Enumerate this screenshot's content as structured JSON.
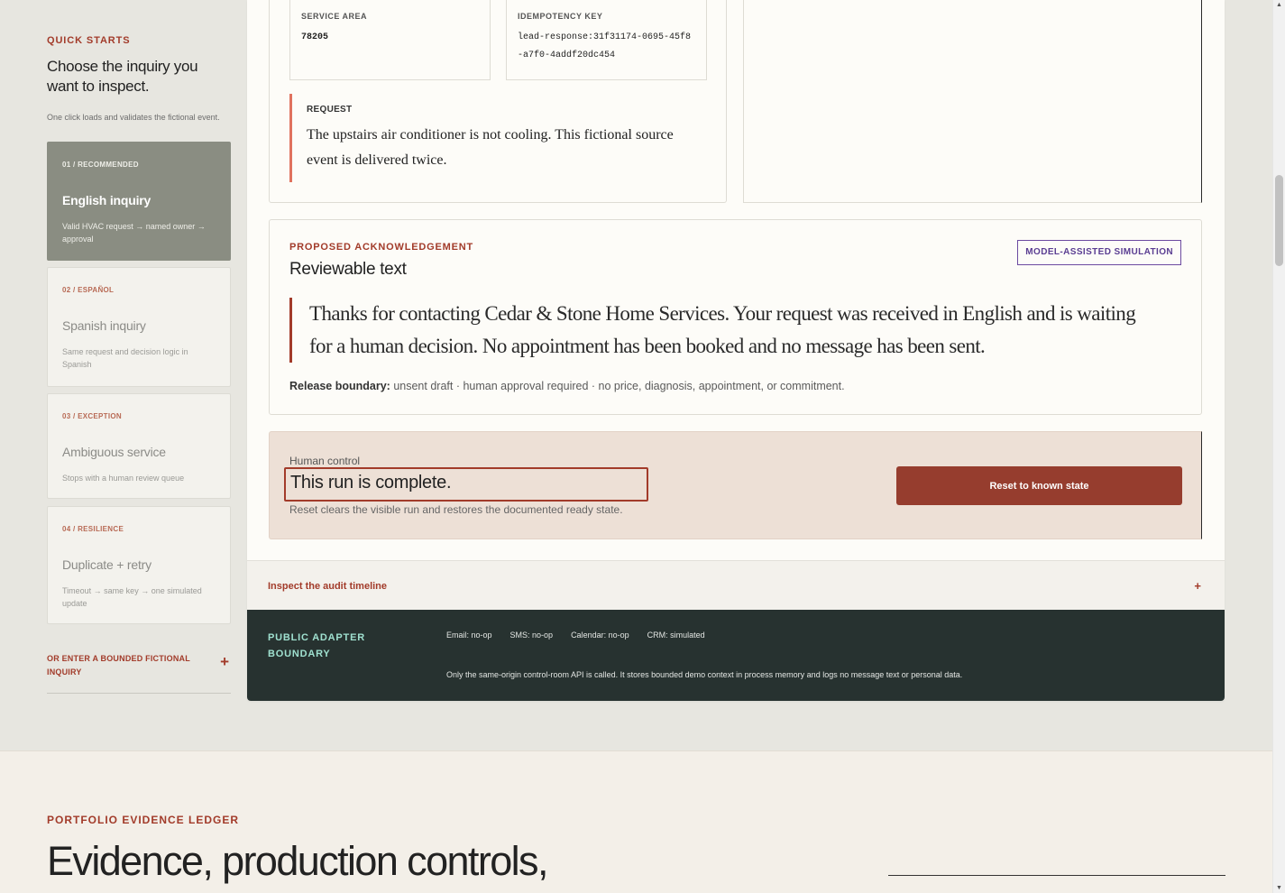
{
  "quick_starts": {
    "label": "QUICK STARTS",
    "title": "Choose the inquiry you want to inspect.",
    "subtitle": "One click loads and validates the fictional event.",
    "cards": [
      {
        "kicker": "01 / RECOMMENDED",
        "title": "English inquiry",
        "desc": "Valid HVAC request → named owner → approval"
      },
      {
        "kicker": "02 / ESPAÑOL",
        "title": "Spanish inquiry",
        "desc": "Same request and decision logic in Spanish"
      },
      {
        "kicker": "03 / EXCEPTION",
        "title": "Ambiguous service",
        "desc": "Stops with a human review queue"
      },
      {
        "kicker": "04 / RESILIENCE",
        "title": "Duplicate + retry",
        "desc": "Timeout → same key → one simulated update"
      }
    ],
    "or_enter": "OR ENTER A BOUNDED FICTIONAL INQUIRY",
    "or_enter_icon": "+"
  },
  "fields": {
    "service_area_label": "SERVICE AREA",
    "service_area_value": "78205",
    "idempotency_label": "IDEMPOTENCY KEY",
    "idempotency_value": "lead-response:31f31174-0695-45f8-a7f0-4addf20dc454"
  },
  "request": {
    "label": "REQUEST",
    "text": "The upstairs air conditioner is not cooling. This fictional source event is delivered twice."
  },
  "acknowledgement": {
    "kicker": "PROPOSED ACKNOWLEDGEMENT",
    "title": "Reviewable text",
    "badge": "MODEL-ASSISTED SIMULATION",
    "quote": "Thanks for contacting Cedar & Stone Home Services. Your request was received in English and is waiting for a human decision. No appointment has been booked and no message has been sent.",
    "release_label": "Release boundary:",
    "release_text": "unsent draft · human approval required · no price, diagnosis, appointment, or commitment."
  },
  "human_control": {
    "label": "Human control",
    "title": "This run is complete.",
    "subtitle": "Reset clears the visible run and restores the documented ready state.",
    "reset_button": "Reset to known state"
  },
  "audit": {
    "label": "Inspect the audit timeline",
    "icon": "+"
  },
  "adapter": {
    "kicker": "PUBLIC ADAPTER BOUNDARY",
    "chips": [
      "Email: no-op",
      "SMS: no-op",
      "Calendar: no-op",
      "CRM: simulated"
    ],
    "note": "Only the same-origin control-room API is called. It stores bounded demo context in process memory and logs no message text or personal data."
  },
  "ledger": {
    "kicker": "PORTFOLIO EVIDENCE LEDGER",
    "title": "Evidence, production controls,"
  },
  "colors": {
    "accent": "#a23b2a",
    "active_card": "#8a8d82",
    "button": "#963d2e",
    "adapter_bg": "#273230",
    "adapter_accent": "#9fe0cf",
    "badge": "#5a3d92"
  }
}
